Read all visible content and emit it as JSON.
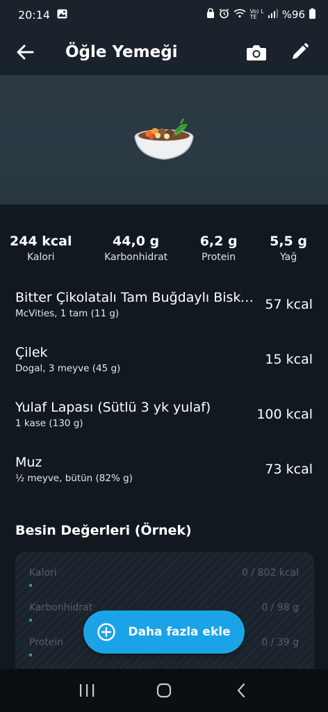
{
  "status_bar": {
    "time": "20:14",
    "battery": "%96",
    "network": "Vo) LTE"
  },
  "app_bar": {
    "title": "Öğle Yemeği",
    "back_icon": "arrow-left-icon",
    "camera_icon": "camera-icon",
    "edit_icon": "pencil-icon"
  },
  "hero": {
    "emoji": "🍲"
  },
  "summary": [
    {
      "value": "244 kcal",
      "label": "Kalori"
    },
    {
      "value": "44,0 g",
      "label": "Karbonhidrat"
    },
    {
      "value": "6,2 g",
      "label": "Protein"
    },
    {
      "value": "5,5 g",
      "label": "Yağ"
    }
  ],
  "foods": [
    {
      "name": "Bitter  Çikolatalı Tam Buğdaylı Bisküvi",
      "detail": "McVities, 1 tam (11 g)",
      "kcal": "57 kcal"
    },
    {
      "name": "Çilek",
      "detail": "Dogal, 3 meyve (45 g)",
      "kcal": "15 kcal"
    },
    {
      "name": "Yulaf Lapası (Sütlü 3 yk yulaf)",
      "detail": "1 kase (130 g)",
      "kcal": "100 kcal"
    },
    {
      "name": "Muz",
      "detail": "½ meyve, bütün (82% g)",
      "kcal": "73 kcal"
    }
  ],
  "nutrition": {
    "title": "Besin Değerleri (Örnek)",
    "rows": [
      {
        "label": "Kalori",
        "value": "0 / 802 kcal"
      },
      {
        "label": "Karbonhidrat",
        "value": "0 / 98 g"
      },
      {
        "label": "Protein",
        "value": "0 / 39 g"
      }
    ]
  },
  "fab": {
    "label": "Daha fazla ekle",
    "icon": "plus-circle-icon"
  },
  "colors": {
    "accent": "#1aa3e6",
    "background": "#111820",
    "app_bar": "#1a222b"
  }
}
